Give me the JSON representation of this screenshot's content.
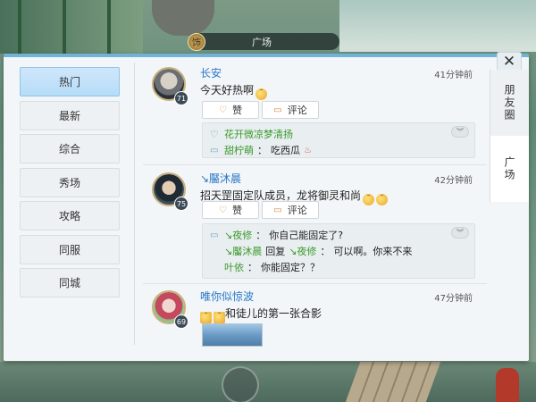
{
  "channel": {
    "badge": "饰",
    "name": "广场"
  },
  "close_label": "✕",
  "nav": [
    {
      "label": "热门",
      "active": true
    },
    {
      "label": "最新"
    },
    {
      "label": "综合"
    },
    {
      "label": "秀场"
    },
    {
      "label": "攻略"
    },
    {
      "label": "同服"
    },
    {
      "label": "同城"
    }
  ],
  "tabs": [
    {
      "label": "朋友圈"
    },
    {
      "label": "广场",
      "active": true
    }
  ],
  "actions": {
    "like": "赞",
    "comment": "评论"
  },
  "posts": [
    {
      "user": "长安",
      "level": "71",
      "time": "41分钟前",
      "content": "今天好热啊",
      "likes": {
        "name": "花开微凉梦清扬"
      },
      "comments": [
        {
          "author": "甜柠萌",
          "sep": "：",
          "text": "吃西瓜"
        }
      ]
    },
    {
      "user": "↘靨沐晨",
      "level": "75",
      "time": "42分钟前",
      "content": "招天罡固定队成员，龙将御灵和尚",
      "comments": [
        {
          "author": "↘夜修",
          "sep": "：",
          "text": "你自己能固定了?"
        },
        {
          "author": "↘靨沐晨",
          "mid": "回复",
          "target": "↘夜修",
          "sep": "：",
          "text": "可以啊。你来不来"
        },
        {
          "author": "叶依",
          "sep": "：",
          "text": "你能固定？？"
        }
      ]
    },
    {
      "user": "唯你似惊波",
      "level": "69",
      "time": "47分钟前",
      "content": "和徒儿的第一张合影"
    }
  ]
}
